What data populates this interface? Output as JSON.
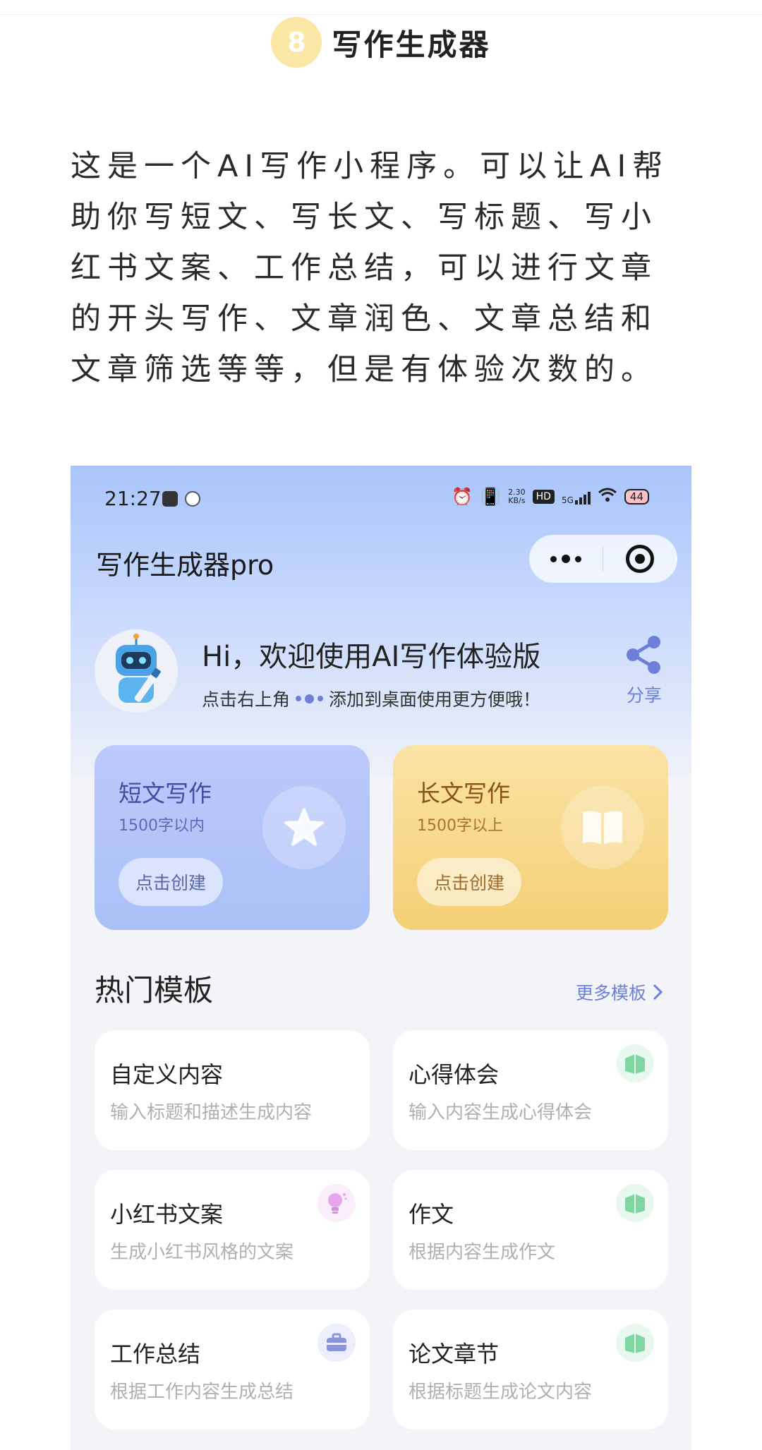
{
  "section": {
    "number": "8",
    "title": "写作生成器"
  },
  "article": {
    "text": "这是一个AI写作小程序。可以让AI帮助你写短文、写长文、写标题、写小红书文案、工作总结，可以进行文章的开头写作、文章润色、文章总结和文章筛选等等，但是有体验次数的。"
  },
  "status_bar": {
    "time": "21:27",
    "net_speed": "2.30",
    "net_unit": "KB/s",
    "hd": "HD",
    "signal": "5G",
    "battery": "44"
  },
  "app": {
    "title": "写作生成器pro"
  },
  "welcome": {
    "title": "Hi，欢迎使用AI写作体验版",
    "sub_before": "点击右上角",
    "sub_after": "添加到桌面使用更方便哦！",
    "share_label": "分享"
  },
  "cards": [
    {
      "title": "短文写作",
      "subtitle": "1500字以内",
      "button": "点击创建"
    },
    {
      "title": "长文写作",
      "subtitle": "1500字以上",
      "button": "点击创建"
    }
  ],
  "templates": {
    "heading": "热门模板",
    "more": "更多模板",
    "items": [
      {
        "title": "自定义内容",
        "desc": "输入标题和描述生成内容",
        "icon": "none"
      },
      {
        "title": "心得体会",
        "desc": "输入内容生成心得体会",
        "icon": "book-icon"
      },
      {
        "title": "小红书文案",
        "desc": "生成小红书风格的文案",
        "icon": "bulb-icon"
      },
      {
        "title": "作文",
        "desc": "根据内容生成作文",
        "icon": "book-icon"
      },
      {
        "title": "工作总结",
        "desc": "根据工作内容生成总结",
        "icon": "briefcase-icon"
      },
      {
        "title": "论文章节",
        "desc": "根据标题生成论文内容",
        "icon": "book-icon"
      }
    ]
  },
  "colors": {
    "accent": "#6f7fd8",
    "badge": "#fbe7a6",
    "card_blue": "#bcc9fb",
    "card_yellow": "#f4cf74",
    "book_icon": "#7fd6a0"
  }
}
